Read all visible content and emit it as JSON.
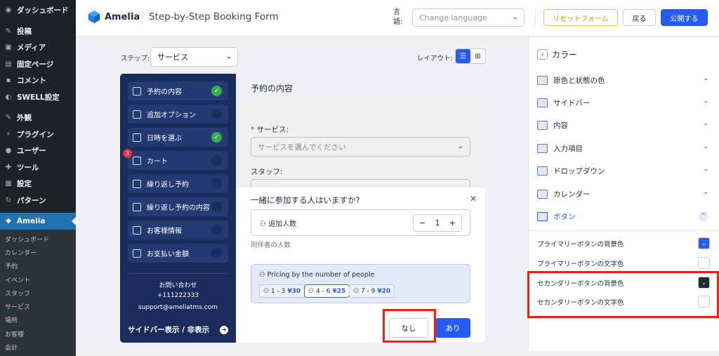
{
  "wp_menu": {
    "items": [
      {
        "label": "ダッシュボード",
        "icon": "dashboard-icon",
        "glyph": "◉"
      },
      {
        "label": "投稿",
        "icon": "pin-icon",
        "glyph": "✎"
      },
      {
        "label": "メディア",
        "icon": "media-icon",
        "glyph": "▣"
      },
      {
        "label": "固定ページ",
        "icon": "page-icon",
        "glyph": "▤"
      },
      {
        "label": "コメント",
        "icon": "comment-icon",
        "glyph": "▪"
      },
      {
        "label": "SWELL設定",
        "icon": "swell-icon",
        "glyph": "◐"
      },
      {
        "label": "外観",
        "icon": "appearance-icon",
        "glyph": "✎"
      },
      {
        "label": "プラグイン",
        "icon": "plugin-icon",
        "glyph": "⚡"
      },
      {
        "label": "ユーザー",
        "icon": "user-icon",
        "glyph": "●"
      },
      {
        "label": "ツール",
        "icon": "tools-icon",
        "glyph": "✚"
      },
      {
        "label": "設定",
        "icon": "settings-icon",
        "glyph": "▦"
      },
      {
        "label": "パターン",
        "icon": "pattern-icon",
        "glyph": "↻"
      },
      {
        "label": "Amelia",
        "icon": "amelia-icon",
        "glyph": "◆"
      }
    ],
    "subitems": [
      "ダッシュボード",
      "カレンダー",
      "予約",
      "イベント",
      "スタッフ",
      "サービス",
      "場所",
      "お客様",
      "会計"
    ]
  },
  "topbar": {
    "brand": "Amelia",
    "page_title": "Step-by-Step Booking Form",
    "language_label": "言語:",
    "language_placeholder": "Change language",
    "reset_label": "リセットフォーム",
    "back_label": "戻る",
    "publish_label": "公開する"
  },
  "builder": {
    "step_label": "ステップ:",
    "step_value": "サービス",
    "layout_label": "レイアウト:"
  },
  "form_sidebar": {
    "steps": [
      {
        "label": "予約の内容",
        "done": true
      },
      {
        "label": "追加オプション",
        "done": false
      },
      {
        "label": "日時を選ぶ",
        "done": true
      },
      {
        "label": "カート",
        "done": false
      },
      {
        "label": "繰り返し予約",
        "done": false
      },
      {
        "label": "繰り返し予約の内容",
        "done": false
      },
      {
        "label": "お客様情報",
        "done": false
      },
      {
        "label": "お支払い金額",
        "done": false
      }
    ],
    "cart_badge": "3",
    "contact_title": "お問い合わせ",
    "contact_phone": "+111222333",
    "contact_email": "support@ameliatms.com",
    "toggle_label": "サイドバー表示 / 非表示"
  },
  "form_main": {
    "header": "予約の内容",
    "service_label": "サービス:",
    "service_placeholder": "サービスを選んでください",
    "staff_label": "スタッフ:"
  },
  "modal": {
    "title": "一緒に参加する人はいますか?",
    "people_label": "追加人数",
    "count": "1",
    "minus": "−",
    "plus": "+",
    "hint": "同伴者の人数",
    "pricing_title": "Pricing by the number of people",
    "tiers": [
      {
        "range": "1 - 3",
        "price": "¥30"
      },
      {
        "range": "4 - 6",
        "price": "¥25"
      },
      {
        "range": "7 - 9",
        "price": "¥20"
      }
    ],
    "no_label": "なし",
    "yes_label": "あり"
  },
  "right_panel": {
    "title": "カラー",
    "sections": [
      "原色と状態の色",
      "サイドバー",
      "内容",
      "入力項目",
      "ドロップダウン",
      "カレンダー",
      "ボタン"
    ],
    "color_rows": [
      {
        "label": "プライマリーボタンの背景色",
        "color": "#265cf2"
      },
      {
        "label": "プライマリーボタンの文字色",
        "color": "#ffffff"
      },
      {
        "label": "セカンダリーボタンの背景色",
        "color": "#1d2a30"
      },
      {
        "label": "セカンダリーボタンの文字色",
        "color": "#ffffff"
      }
    ]
  },
  "colors": {
    "accent": "#265cf2",
    "form_sidebar": "#1a2c5b",
    "highlight": "#f0220d",
    "success": "#2fb24c"
  }
}
